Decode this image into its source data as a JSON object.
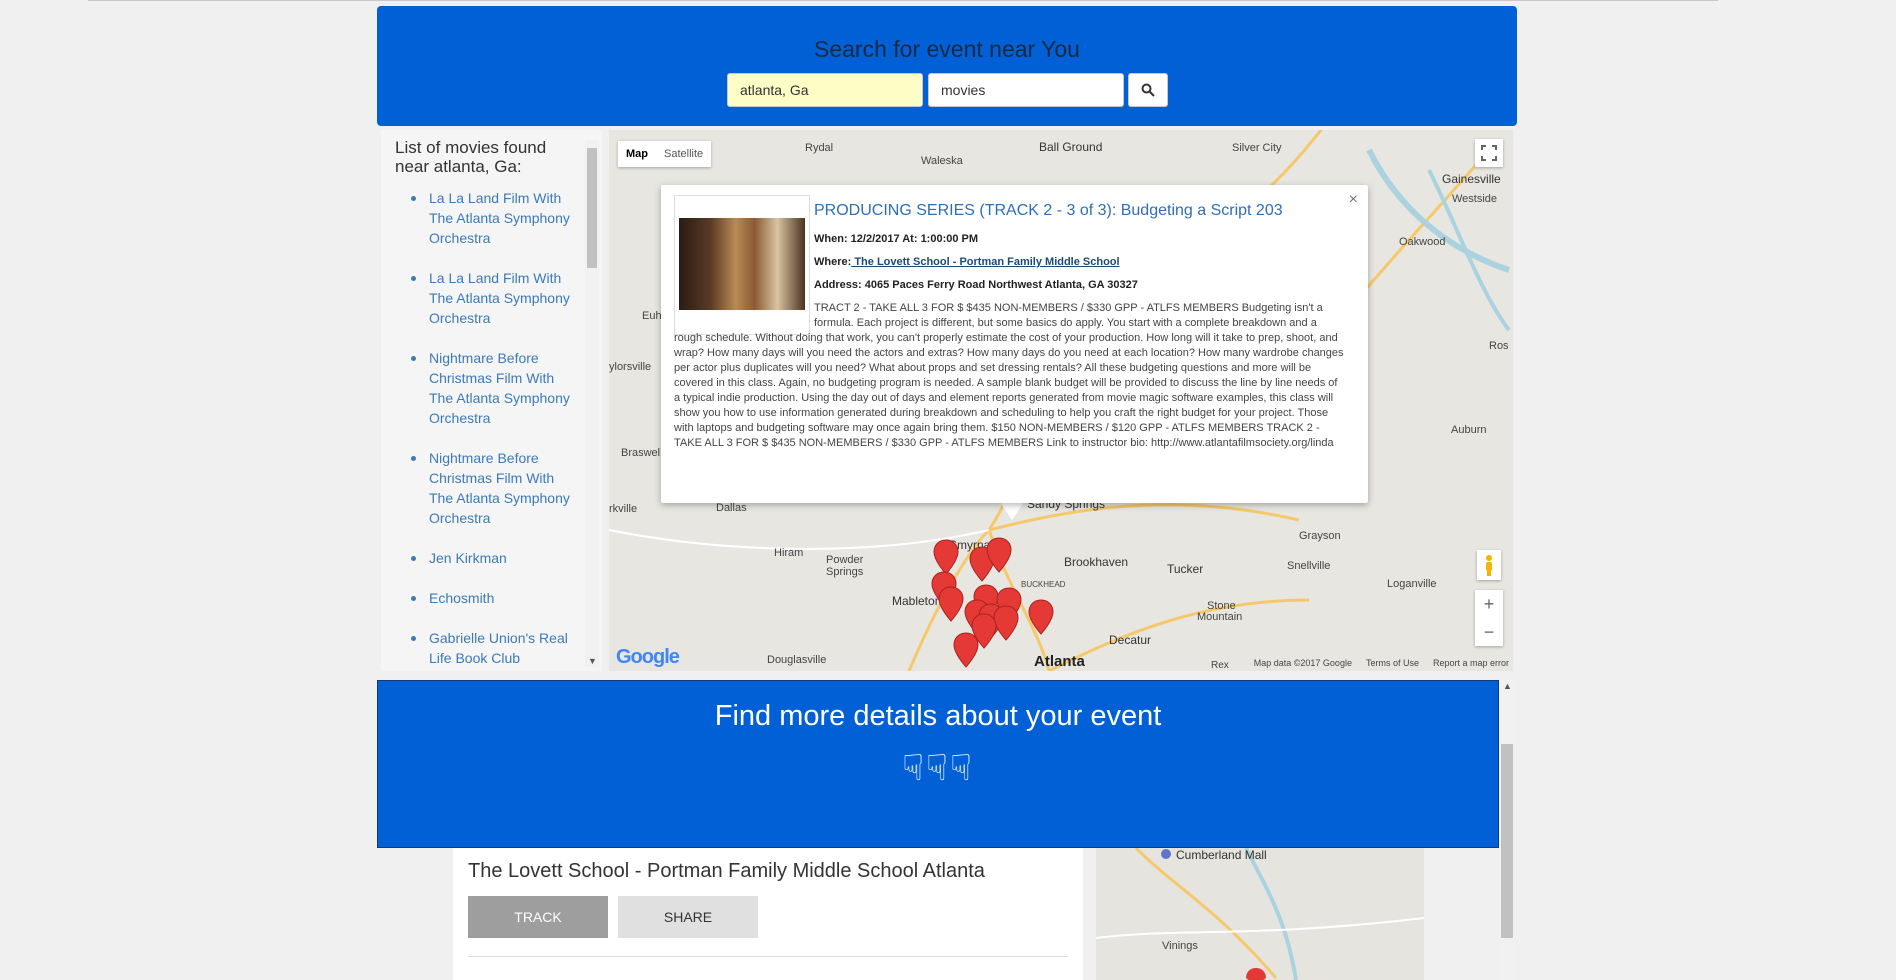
{
  "search": {
    "title": "Search for event near You",
    "location_value": "atlanta, Ga",
    "keyword_value": "movies",
    "button_icon": "search-icon"
  },
  "sidebar": {
    "title": "List of movies found near atlanta, Ga:",
    "items": [
      "La La Land Film With The Atlanta Symphony Orchestra",
      "La La Land Film With The Atlanta Symphony Orchestra",
      "Nightmare Before Christmas Film With The Atlanta Symphony Orchestra",
      "Nightmare Before Christmas Film With The Atlanta Symphony Orchestra",
      "Jen Kirkman",
      "Echosmith",
      "Gabrielle Union's Real Life Book Club"
    ]
  },
  "map": {
    "type_map": "Map",
    "type_satellite": "Satellite",
    "zoom_in": "+",
    "zoom_out": "−",
    "logo": "Google",
    "attribution": "Map data ©2017 Google",
    "terms": "Terms of Use",
    "report": "Report a map error",
    "places": {
      "rydal": "Rydal",
      "waleska": "Waleska",
      "ball_ground": "Ball Ground",
      "silver_city": "Silver City",
      "gainesville": "Gainesville",
      "westside": "Westside",
      "oakwood": "Oakwood",
      "euharlee": "Euh",
      "taylorsville": "ylorsville",
      "braswell": "Braswel",
      "ros": "Ros",
      "auburn": "Auburn",
      "sandy_springs": "Sandy Springs",
      "dallas": "Dallas",
      "rockmart": "rkville",
      "hiram": "Hiram",
      "powder_springs_1": "Powder",
      "powder_springs_2": "Springs",
      "smyrna": "Smyrna",
      "brookhaven": "Brookhaven",
      "buckhead": "BUCKHEAD",
      "tucker": "Tucker",
      "grayson": "Grayson",
      "snellville": "Snellville",
      "loganville": "Loganville",
      "mableton": "Mableton",
      "stone_mountain_1": "Stone",
      "stone_mountain_2": "Mountain",
      "decatur": "Decatur",
      "douglasville": "Douglasville",
      "atlanta": "Atlanta",
      "rex": "Rex"
    }
  },
  "infowindow": {
    "title": "PRODUCING SERIES (TRACK 2 - 3 of 3): Budgeting a Script 203",
    "when": "When: 12/2/2017 At: 1:00:00 PM",
    "where_label": "Where:",
    "where_link": " The Lovett School - Portman Family Middle School",
    "address": "Address: 4065 Paces Ferry Road Northwest Atlanta, GA 30327",
    "description": "TRACT 2 - TAKE ALL 3 FOR $ $435 NON-MEMBERS / $330 GPP - ATLFS MEMBERS Budgeting isn't a formula. Each project is different, but some basics do apply. You start with a complete breakdown and a rough schedule. Without doing that work, you can't properly estimate the cost of your production. How long will it take to prep, shoot, and wrap? How many days will you need the actors and extras? How many days do you need at each location? How many wardrobe changes per actor plus duplicates will you need? What about props and set dressing rentals? All these budgeting questions and more will be covered in this class. Again, no budgeting program is needed. A sample blank budget will be provided to discuss the line by line needs of a typical indie production. Using the day out of days and element reports generated from movie magic software examples, this class will show you how to use information generated during breakdown and scheduling to help you craft the right budget for your project. Those with laptops and budgeting software may once again bring them. $150 NON-MEMBERS / $120 GPP - ATLFS MEMBERS TRACK 2 - TAKE ALL 3 FOR $ $435 NON-MEMBERS / $330 GPP - ATLFS MEMBERS Link to instructor bio: http://www.atlantafilmsociety.org/linda",
    "close": "×"
  },
  "details": {
    "title": "Find more details about your event",
    "icons": "☟☟☟"
  },
  "event": {
    "venue_title": "The Lovett School - Portman Family Middle School Atlanta",
    "track_label": "TRACK",
    "share_label": "SHARE"
  },
  "minimap": {
    "places": {
      "cumberland": "Cumberland Mall",
      "vinings": "Vinings"
    }
  },
  "colors": {
    "brand_blue": "#0260d6",
    "link_blue": "#3c7ab8",
    "marker_red": "#e53935"
  }
}
